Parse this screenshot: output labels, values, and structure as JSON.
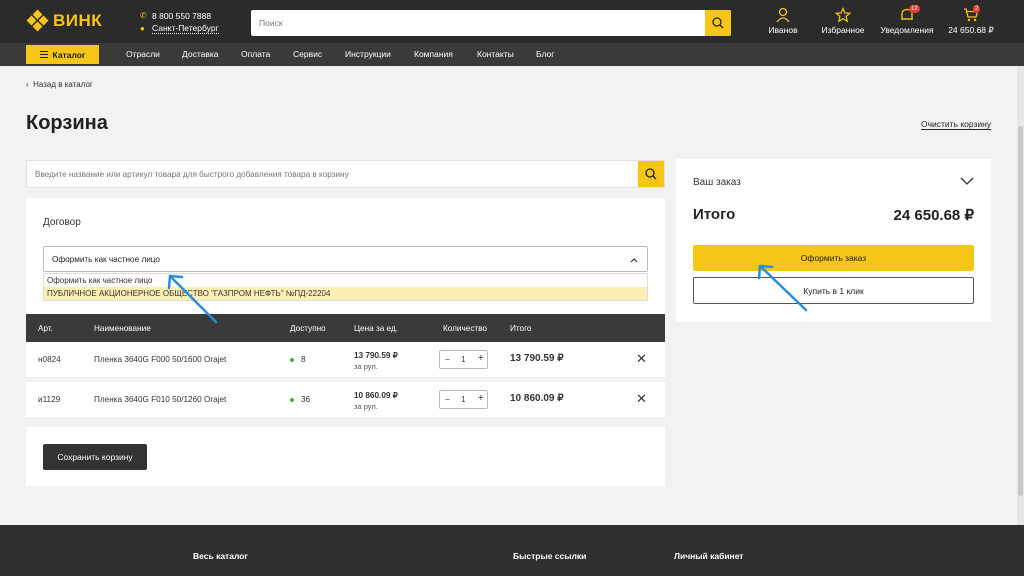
{
  "header": {
    "logo_text": "ВИНК",
    "phone": "8 800 550 7888",
    "city": "Санкт-Петербург",
    "search_placeholder": "Поиск",
    "user_label": "Иванов",
    "favorites_label": "Избранное",
    "notifications_label": "Уведомления",
    "notifications_count": "12",
    "cart_count": "2",
    "cart_total": "24 650.68 ₽"
  },
  "nav": {
    "catalog_label": "Каталог",
    "links": [
      "Отрасли",
      "Доставка",
      "Оплата",
      "Сервис",
      "Инструкции",
      "Компания",
      "Контакты",
      "Блог"
    ]
  },
  "page": {
    "back_label": "Назад в каталог",
    "title": "Корзина",
    "clear_label": "Очистить корзину",
    "quick_search_placeholder": "Введите название или артикул товара для быстрого добавления товара в корзину"
  },
  "contract": {
    "label": "Договор",
    "selected": "Оформить как частное лицо",
    "options": [
      "Оформить как частное лицо",
      "ПУБЛИЧНОЕ АКЦИОНЕРНОЕ ОБЩЕСТВО \"ГАЗПРОМ НЕФТЬ\" №ПД-22204"
    ]
  },
  "table": {
    "headers": [
      "Арт.",
      "Наименование",
      "Доступно",
      "Цена за ед.",
      "Количество",
      "Итого"
    ],
    "rows": [
      {
        "art": "н0824",
        "name": "Пленка 3640G F000 50/1600 Orajet",
        "available": "8",
        "price": "13 790.59 ₽",
        "unit": "за рул.",
        "qty": "1",
        "total": "13 790.59 ₽"
      },
      {
        "art": "и1129",
        "name": "Пленка 3640G F010 50/1260 Orajet",
        "available": "36",
        "price": "10 860.09 ₽",
        "unit": "за рул.",
        "qty": "1",
        "total": "10 860.09 ₽"
      }
    ]
  },
  "save_label": "Сохранить корзину",
  "order": {
    "label": "Ваш заказ",
    "total_label": "Итого",
    "total_value": "24 650.68 ₽",
    "checkout_label": "Оформить заказ",
    "oneclick_label": "Купить в 1 клик"
  },
  "footer": {
    "columns": [
      "Весь каталог",
      "Быстрые ссылки",
      "Личный кабинет"
    ]
  },
  "colors": {
    "accent": "#f5c518",
    "header_bg": "#2b2b2b",
    "annotation_arrow": "#2a8fd8"
  }
}
